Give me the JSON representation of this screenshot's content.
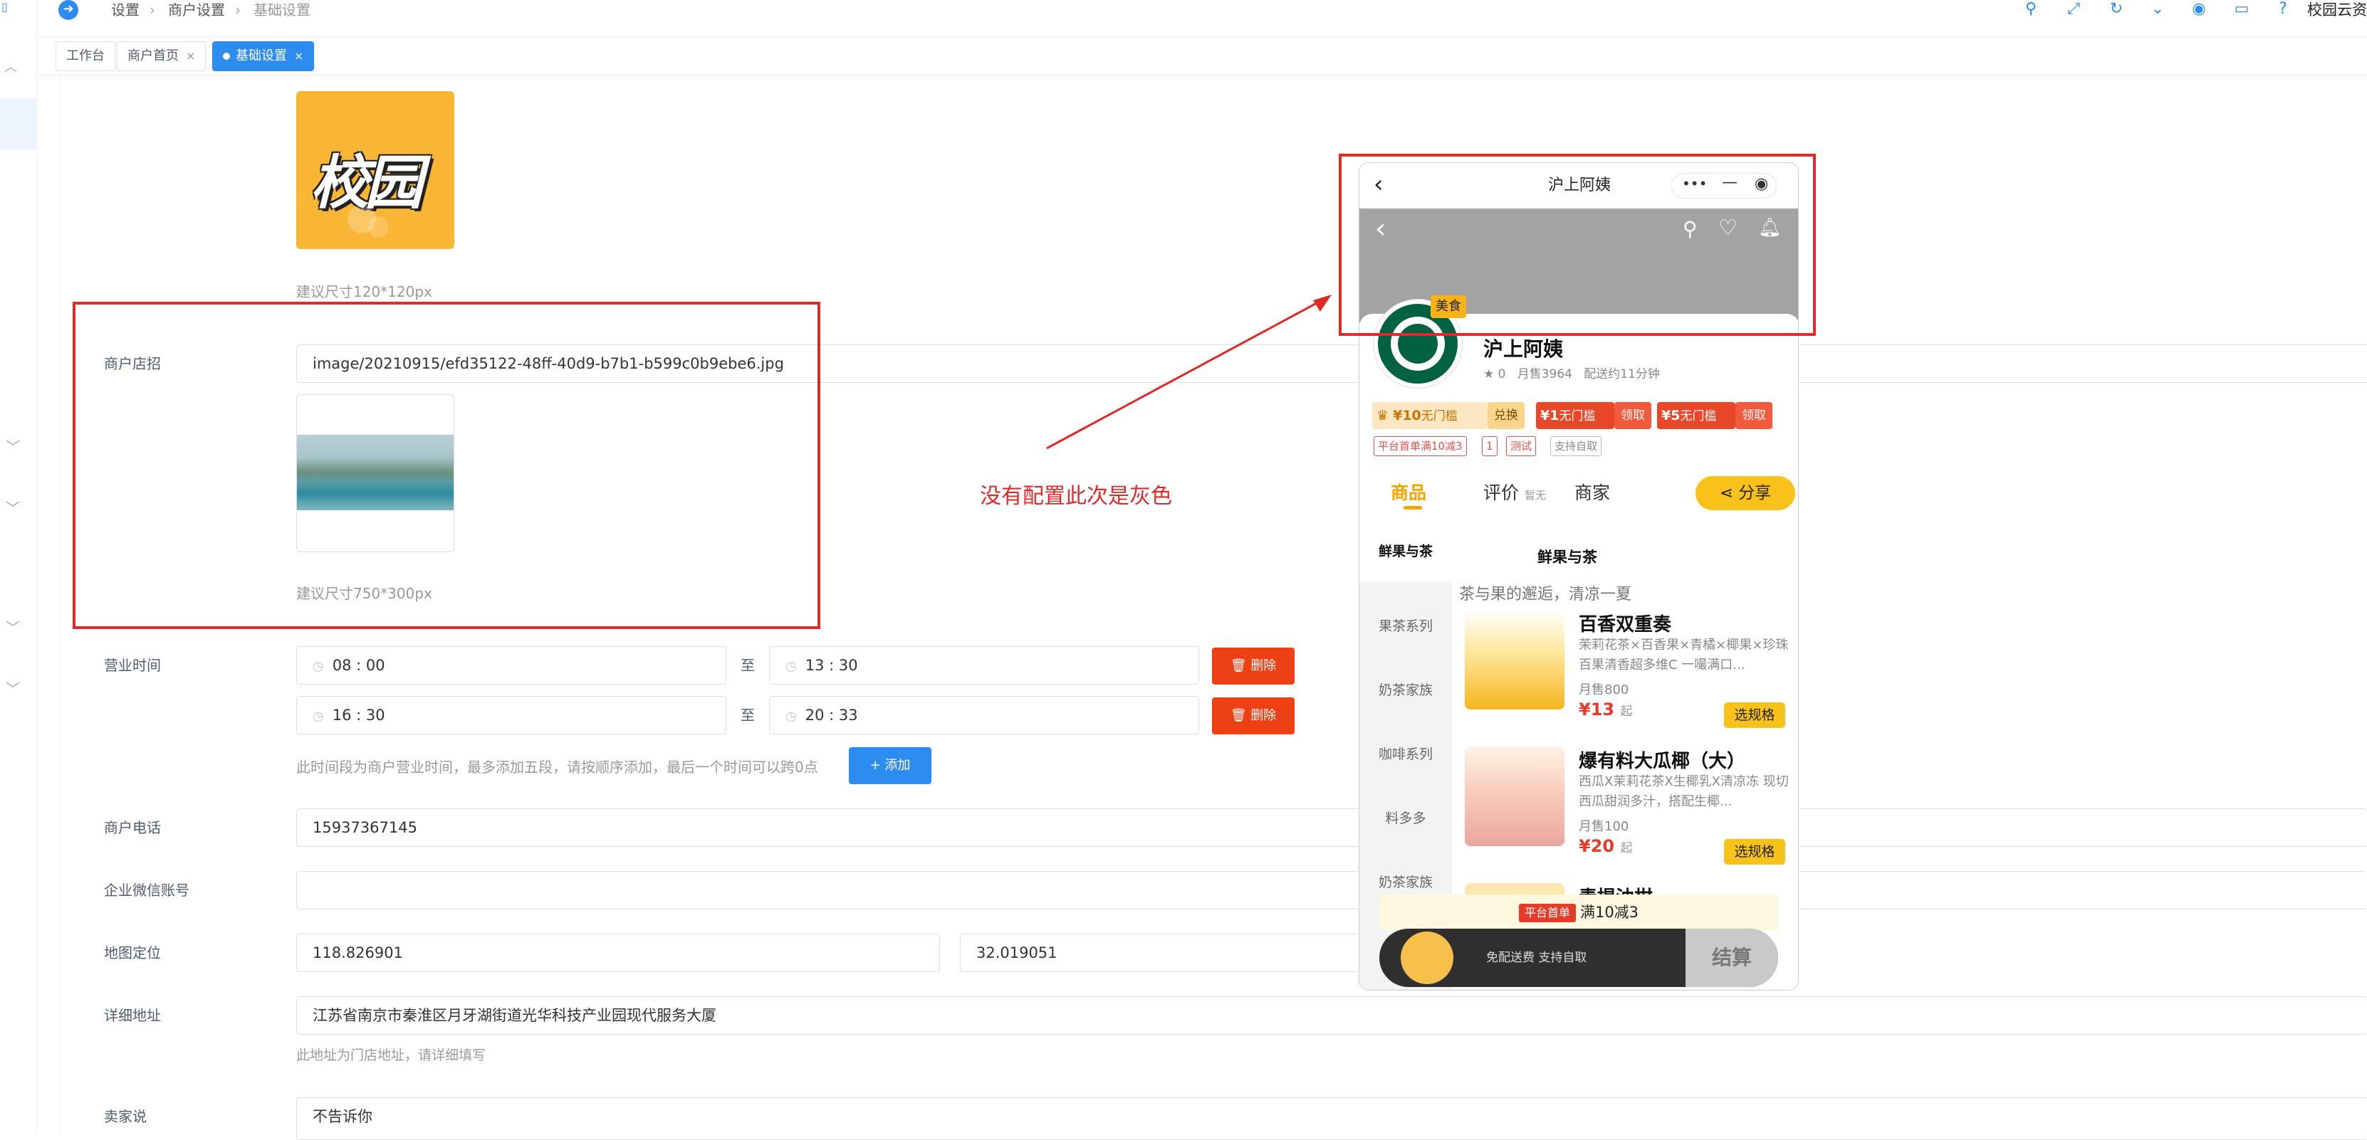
{
  "header": {
    "breadcrumb": [
      "设置",
      "商户设置",
      "基础设置"
    ],
    "site_name": "校园云资",
    "icons": [
      "search-icon",
      "fullscreen-icon",
      "refresh-icon",
      "chevron-down-icon",
      "eye-icon",
      "monitor-icon",
      "help-icon"
    ]
  },
  "tabs": [
    {
      "label": "工作台"
    },
    {
      "label": "商户首页"
    },
    {
      "label": "基础设置",
      "active": true
    }
  ],
  "form": {
    "logo": {
      "text": "校园",
      "hint": "建议尺寸120*120px"
    },
    "banner": {
      "label": "商户店招",
      "value": "image/20210915/efd35122-48ff-40d9-b7b1-b599c0b9ebe6.jpg",
      "hint": "建议尺寸750*300px"
    },
    "hours": {
      "label": "营业时间",
      "rows": [
        {
          "start": "08 : 00",
          "end": "13 : 30"
        },
        {
          "start": "16 : 30",
          "end": "20 : 33"
        }
      ],
      "to_label": "至",
      "delete_label": "删除",
      "hint": "此时间段为商户营业时间，最多添加五段，请按顺序添加，最后一个时间可以跨0点",
      "add_label": "+ 添加"
    },
    "phone": {
      "label": "商户电话",
      "value": "15937367145"
    },
    "wechat": {
      "label": "企业微信账号",
      "value": ""
    },
    "location": {
      "label": "地图定位",
      "lng": "118.826901",
      "lat": "32.019051"
    },
    "address": {
      "label": "详细地址",
      "value": "江苏省南京市秦淮区月牙湖街道光华科技产业园现代服务大厦",
      "hint": "此地址为门店地址，请详细填写"
    },
    "seller_says": {
      "label": "卖家说",
      "value": "不告诉你"
    }
  },
  "annotation": {
    "text": "没有配置此次是灰色",
    "color": "#e02a2a"
  },
  "phone_preview": {
    "title": "沪上阿姨",
    "category_tag": "美食",
    "shop_name": "沪上阿姨",
    "rating": "0",
    "monthly_sales": "月售3964",
    "delivery_time": "配送约11分钟",
    "coupons": [
      {
        "amount": "¥10",
        "desc": "无门槛",
        "action": "兑换"
      },
      {
        "amount": "¥1",
        "desc": "无门槛",
        "action": "领取"
      },
      {
        "amount": "¥5",
        "desc": "无门槛",
        "action": "领取"
      }
    ],
    "tags": [
      "平台首单满10减3",
      "1",
      "测试",
      "支持自取"
    ],
    "tabs": {
      "goods": "商品",
      "reviews": "评价",
      "reviews_sub": "暂无",
      "merchant": "商家",
      "share": "分享"
    },
    "side_menu": [
      "鲜果与茶",
      "果茶系列",
      "奶茶家族",
      "咖啡系列",
      "料多多",
      "奶茶家族"
    ],
    "category": {
      "name": "鲜果与茶",
      "desc": "茶与果的邂逅，清凉一夏"
    },
    "products": [
      {
        "title": "百香双重奏",
        "desc": "茉莉花茶×百香果×青橘×椰果×珍珠 百果清香超多维C 一嘬满口...",
        "sales": "月售800",
        "price": "¥13",
        "unit": "起",
        "spec": "选规格"
      },
      {
        "title": "爆有料大瓜椰（大）",
        "desc": "西瓜X茉莉花茶X生椰乳X清凉冻 现切西瓜甜润多汁，搭配生椰...",
        "sales": "月售100",
        "price": "¥20",
        "unit": "起",
        "spec": "选规格"
      },
      {
        "title": "青提油柑"
      }
    ],
    "promo": {
      "pill": "平台首单",
      "text": "满10减3"
    },
    "bottom": {
      "delivery": "免配送费 支持自取",
      "checkout": "结算"
    }
  },
  "colors": {
    "primary": "#2d8cf0",
    "danger": "#ed4014",
    "accent": "#f8c21b"
  }
}
